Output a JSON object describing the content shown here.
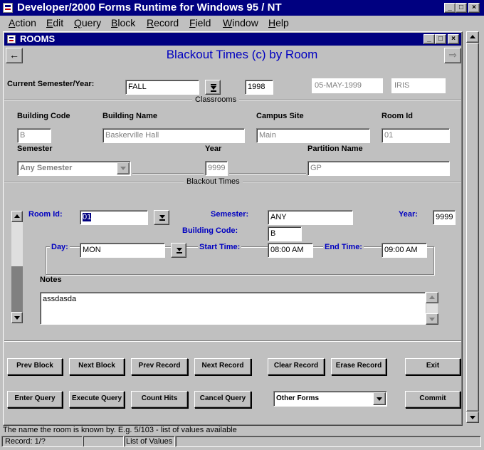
{
  "app": {
    "title": "Developer/2000 Forms Runtime for Windows 95 / NT",
    "menu": [
      {
        "id": "action",
        "label": "Action",
        "accel": "A",
        "rest": "ction"
      },
      {
        "id": "edit",
        "label": "Edit",
        "accel": "E",
        "rest": "dit"
      },
      {
        "id": "query",
        "label": "Query",
        "accel": "Q",
        "rest": "uery"
      },
      {
        "id": "block",
        "label": "Block",
        "accel": "B",
        "rest": "lock"
      },
      {
        "id": "record",
        "label": "Record",
        "accel": "R",
        "rest": "ecord"
      },
      {
        "id": "field",
        "label": "Field",
        "accel": "F",
        "rest": "ield"
      },
      {
        "id": "window",
        "label": "Window",
        "accel": "W",
        "rest": "indow"
      },
      {
        "id": "help",
        "label": "Help",
        "accel": "H",
        "rest": "elp"
      }
    ],
    "window_buttons": {
      "minimize": "_",
      "maximize": "□",
      "close": "×"
    }
  },
  "form": {
    "window_title": "ROOMS",
    "heading": "Blackout Times (c) by Room",
    "header": {
      "semester_year_label": "Current Semester/Year:",
      "semester_value": "FALL",
      "year_value": "1998",
      "date_value": "05-MAY-1999",
      "user_value": "IRIS"
    },
    "classrooms": {
      "frame_title": "Classrooms",
      "building_code_label": "Building Code",
      "building_code_value": "B",
      "building_name_label": "Building Name",
      "building_name_value": "Baskerville Hall",
      "campus_site_label": "Campus Site",
      "campus_site_value": "Main",
      "room_id_label": "Room Id",
      "room_id_value": "01",
      "semester_label": "Semester",
      "semester_value": "Any Semester",
      "year_label": "Year",
      "year_value": "9999",
      "partition_label": "Partition Name",
      "partition_value": "GP"
    },
    "blackout": {
      "frame_title": "Blackout Times",
      "room_id_label": "Room Id:",
      "room_id_value": "01",
      "semester_label": "Semester:",
      "semester_value": "ANY",
      "year_label": "Year:",
      "year_value": "9999",
      "building_code_label": "Building Code:",
      "building_code_value": "B",
      "day_label": "Day:",
      "day_value": "MON",
      "start_time_label": "Start Time:",
      "start_time_value": "08:00 AM",
      "end_time_label": "End Time:",
      "end_time_value": "09:00 AM",
      "notes_label": "Notes",
      "notes_value": "assdasda"
    },
    "buttons_row1": {
      "prev_block": "Prev Block",
      "next_block": "Next Block",
      "prev_record": "Prev Record",
      "next_record": "Next Record",
      "clear_record": "Clear Record",
      "erase_record": "Erase Record",
      "exit": "Exit"
    },
    "buttons_row2": {
      "enter_query": "Enter Query",
      "execute_query": "Execute Query",
      "count_hits": "Count Hits",
      "cancel_query": "Cancel Query",
      "other_forms": "Other Forms",
      "commit": "Commit"
    }
  },
  "status": {
    "hint": "The name the room is known by. E.g. 5/103 - list of values available",
    "record": "Record: 1/?",
    "lov": "List of Values"
  },
  "colors": {
    "titlebar": "#000080",
    "heading": "#0000c0",
    "face": "#c0c0c0",
    "highlight": "#000080"
  }
}
